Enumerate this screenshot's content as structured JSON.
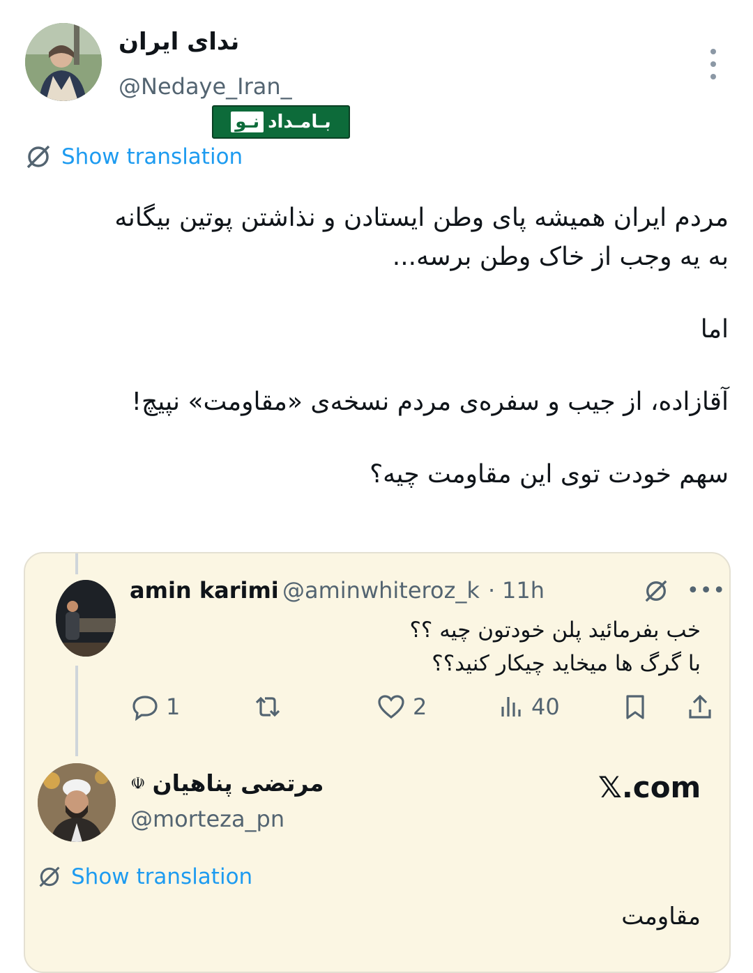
{
  "main_tweet": {
    "display_name": "ندای ایران",
    "handle": "@Nedaye_Iran_",
    "watermark_text_left": "بـامـداد",
    "watermark_text_right": "نـو",
    "show_translation": "Show translation",
    "body": {
      "line1": "مردم ایران همیشه پای وطن ایستادن و نذاشتن پوتین بیگانه",
      "line2": "به یه وجب از خاک وطن برسه...",
      "line3": "اما",
      "line4": "آقازاده، از جیب و سفره‌ی مردم نسخه‌ی «مقاومت» نپیچ!",
      "line5": "سهم خودت توی این مقاومت چیه؟"
    }
  },
  "reply": {
    "display_name": "amin karimi",
    "handle": "@aminwhiteroz_k",
    "separator": "·",
    "time": "11h",
    "body_line1": "خب بفرمائید پلن خودتون چیه ؟؟",
    "body_line2": "با گرگ ها میخاید چیکار کنید؟؟",
    "actions": {
      "replies": "1",
      "likes": "2",
      "views": "40"
    }
  },
  "quoted_tweet": {
    "display_name": "مرتضی پناهیان",
    "flag_symbol": "☫",
    "handle": "@morteza_pn",
    "site": "𝕏.com",
    "show_translation": "Show translation",
    "body": "مقاومت"
  },
  "icons": {
    "translate": "translate-icon",
    "more": "more-icon",
    "reply": "reply-icon",
    "retweet": "retweet-icon",
    "like": "heart-icon",
    "views": "views-icon",
    "bookmark": "bookmark-icon",
    "share": "share-icon"
  },
  "colors": {
    "link": "#1d9bf0",
    "secondary_text": "#536471",
    "card_background": "#fbf6e3",
    "watermark_green": "#0d6b3a"
  }
}
